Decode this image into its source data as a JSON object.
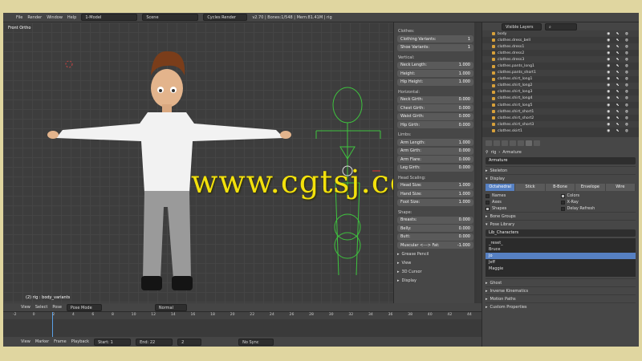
{
  "menu": {
    "file": "File",
    "render": "Render",
    "window": "Window",
    "help": "Help",
    "layout": "1-Model",
    "scene": "Scene",
    "engine": "Cycles Render",
    "stats": "v2.70 | Bones:1/548 | Mem:81.41M | rig"
  },
  "viewport": {
    "label": "Front Ortho",
    "status": "(2) rig : body_variants"
  },
  "watermark": "www.cgtsj.com",
  "props": {
    "clothes_title": "Clothes:",
    "clothes": [
      {
        "label": "Clothing Variants:",
        "value": "1"
      },
      {
        "label": "Shoe Variants:",
        "value": "1"
      }
    ],
    "vertical_title": "Vertical:",
    "vertical": [
      {
        "label": "Neck Length:",
        "value": "1.000"
      },
      {
        "label": "Height:",
        "value": "1.000"
      },
      {
        "label": "Hip Height:",
        "value": "1.000"
      }
    ],
    "horizontal_title": "Horizontal:",
    "horizontal": [
      {
        "label": "Neck Girth:",
        "value": "0.000"
      },
      {
        "label": "Chest Girth:",
        "value": "0.000"
      },
      {
        "label": "Waist Girth:",
        "value": "0.000"
      },
      {
        "label": "Hip Girth:",
        "value": "0.000"
      }
    ],
    "limbs_title": "Limbs:",
    "limbs": [
      {
        "label": "Arm Length:",
        "value": "1.000"
      },
      {
        "label": "Arm Girth:",
        "value": "0.000"
      },
      {
        "label": "Arm Flare:",
        "value": "0.000"
      },
      {
        "label": "Leg Girth:",
        "value": "0.000"
      }
    ],
    "scaling_title": "Head Scaling:",
    "scaling": [
      {
        "label": "Head Size:",
        "value": "1.000"
      },
      {
        "label": "Hand Size:",
        "value": "1.000"
      },
      {
        "label": "Foot Size:",
        "value": "1.000"
      }
    ],
    "shape_title": "Shape:",
    "shape": [
      {
        "label": "Breasts:",
        "value": "0.000"
      },
      {
        "label": "Belly:",
        "value": "0.000"
      },
      {
        "label": "Butt:",
        "value": "0.000"
      },
      {
        "label": "Muscular <---> Fat:",
        "value": "-1.000"
      }
    ],
    "collapsed": [
      "Grease Pencil",
      "View",
      "3D Cursor",
      "Display"
    ]
  },
  "outliner": {
    "view": "Visible Layers",
    "items": [
      "body",
      "clothes.dress_bell",
      "clothes.dress1",
      "clothes.dress2",
      "clothes.dress3",
      "clothes.pants_long1",
      "clothes.pants_short1",
      "clothes.shirt_long1",
      "clothes.shirt_long2",
      "clothes.shirt_long3",
      "clothes.shirt_long4",
      "clothes.shirt_long5",
      "clothes.shirt_short1",
      "clothes.shirt_short2",
      "clothes.shirt_short3",
      "clothes.skirt1"
    ]
  },
  "bone_props": {
    "breadcrumb_rig": "rig",
    "breadcrumb_arm": "Armature",
    "name": "Armature",
    "skeleton": "Skeleton",
    "display": "Display",
    "display_modes": [
      "Octahedral",
      "Stick",
      "B-Bone",
      "Envelope",
      "Wire"
    ],
    "checks_left": [
      {
        "label": "Names",
        "on": false
      },
      {
        "label": "Axes",
        "on": false
      },
      {
        "label": "Shapes",
        "on": true
      }
    ],
    "checks_right": [
      {
        "label": "Colors",
        "on": true
      },
      {
        "label": "X-Ray",
        "on": false
      },
      {
        "label": "Delay Refresh",
        "on": false
      }
    ],
    "bone_groups": "Bone Groups",
    "pose_library": "Pose Library",
    "library_name": "Lib_Characters",
    "poses": [
      "_reset_",
      "Bruce",
      "Jo",
      "Jeff",
      "Maggie"
    ],
    "rest": [
      "Ghost",
      "Inverse Kinematics",
      "Motion Paths",
      "Custom Properties"
    ]
  },
  "timeline_header": {
    "view": "View",
    "select": "Select",
    "pose": "Pose",
    "mode": "Pose Mode",
    "pivot": "Normal"
  },
  "timeline": {
    "ticks": [
      "-2",
      "0",
      "2",
      "4",
      "6",
      "8",
      "10",
      "12",
      "14",
      "16",
      "18",
      "20",
      "22",
      "24",
      "26",
      "28",
      "30",
      "32",
      "34",
      "36",
      "38",
      "40",
      "42",
      "44"
    ],
    "current_frame": 2
  },
  "footer": {
    "view": "View",
    "marker": "Marker",
    "frame": "Frame",
    "playback": "Playback",
    "start": "Start:",
    "start_val": "1",
    "end": "End:",
    "end_val": "22",
    "frame_val": "2",
    "sync": "No Sync"
  }
}
